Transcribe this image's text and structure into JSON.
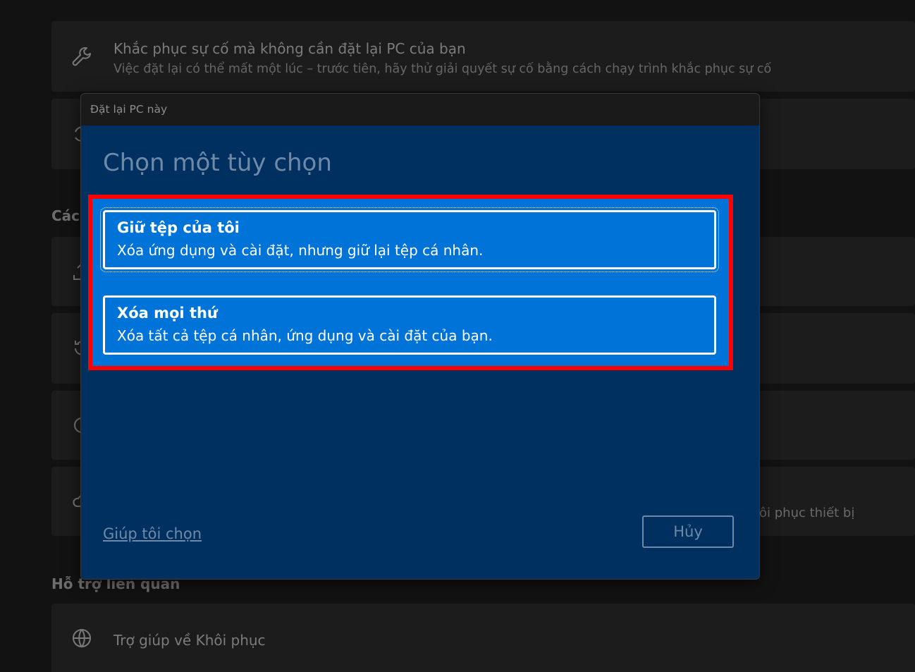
{
  "background": {
    "troubleshoot_card": {
      "title": "Khắc phục sự cố mà không cần đặt lại PC của bạn",
      "subtitle": "Việc đặt lại có thể mất một lúc – trước tiên, hãy thử giải quyết sự cố bằng cách chạy trình khắc phục sự cố"
    },
    "section_heading_partial": "Các",
    "restore_text_partial": "ôi phục thiết bị",
    "related_support_heading": "Hỗ trợ liên quan",
    "recovery_help_card": {
      "title": "Trợ giúp về Khôi phục"
    }
  },
  "dialog": {
    "window_title": "Đặt lại PC này",
    "heading": "Chọn một tùy chọn",
    "options": [
      {
        "title": "Giữ tệp của tôi",
        "description": "Xóa ứng dụng và cài đặt, nhưng giữ lại tệp cá nhân."
      },
      {
        "title": "Xóa mọi thứ",
        "description": "Xóa tất cả tệp cá nhân, ứng dụng và cài đặt của bạn."
      }
    ],
    "help_link": "Giúp tôi chọn",
    "cancel_button": "Hủy"
  },
  "colors": {
    "dialog_background": "#00305f",
    "option_background": "#0073d8",
    "highlight_border": "#ff0000",
    "muted_text": "#6f8aa8"
  },
  "icons": [
    "wrench-icon",
    "reset-icon",
    "upload-icon",
    "history-icon",
    "circle-icon",
    "cloud-icon",
    "globe-help-icon"
  ]
}
